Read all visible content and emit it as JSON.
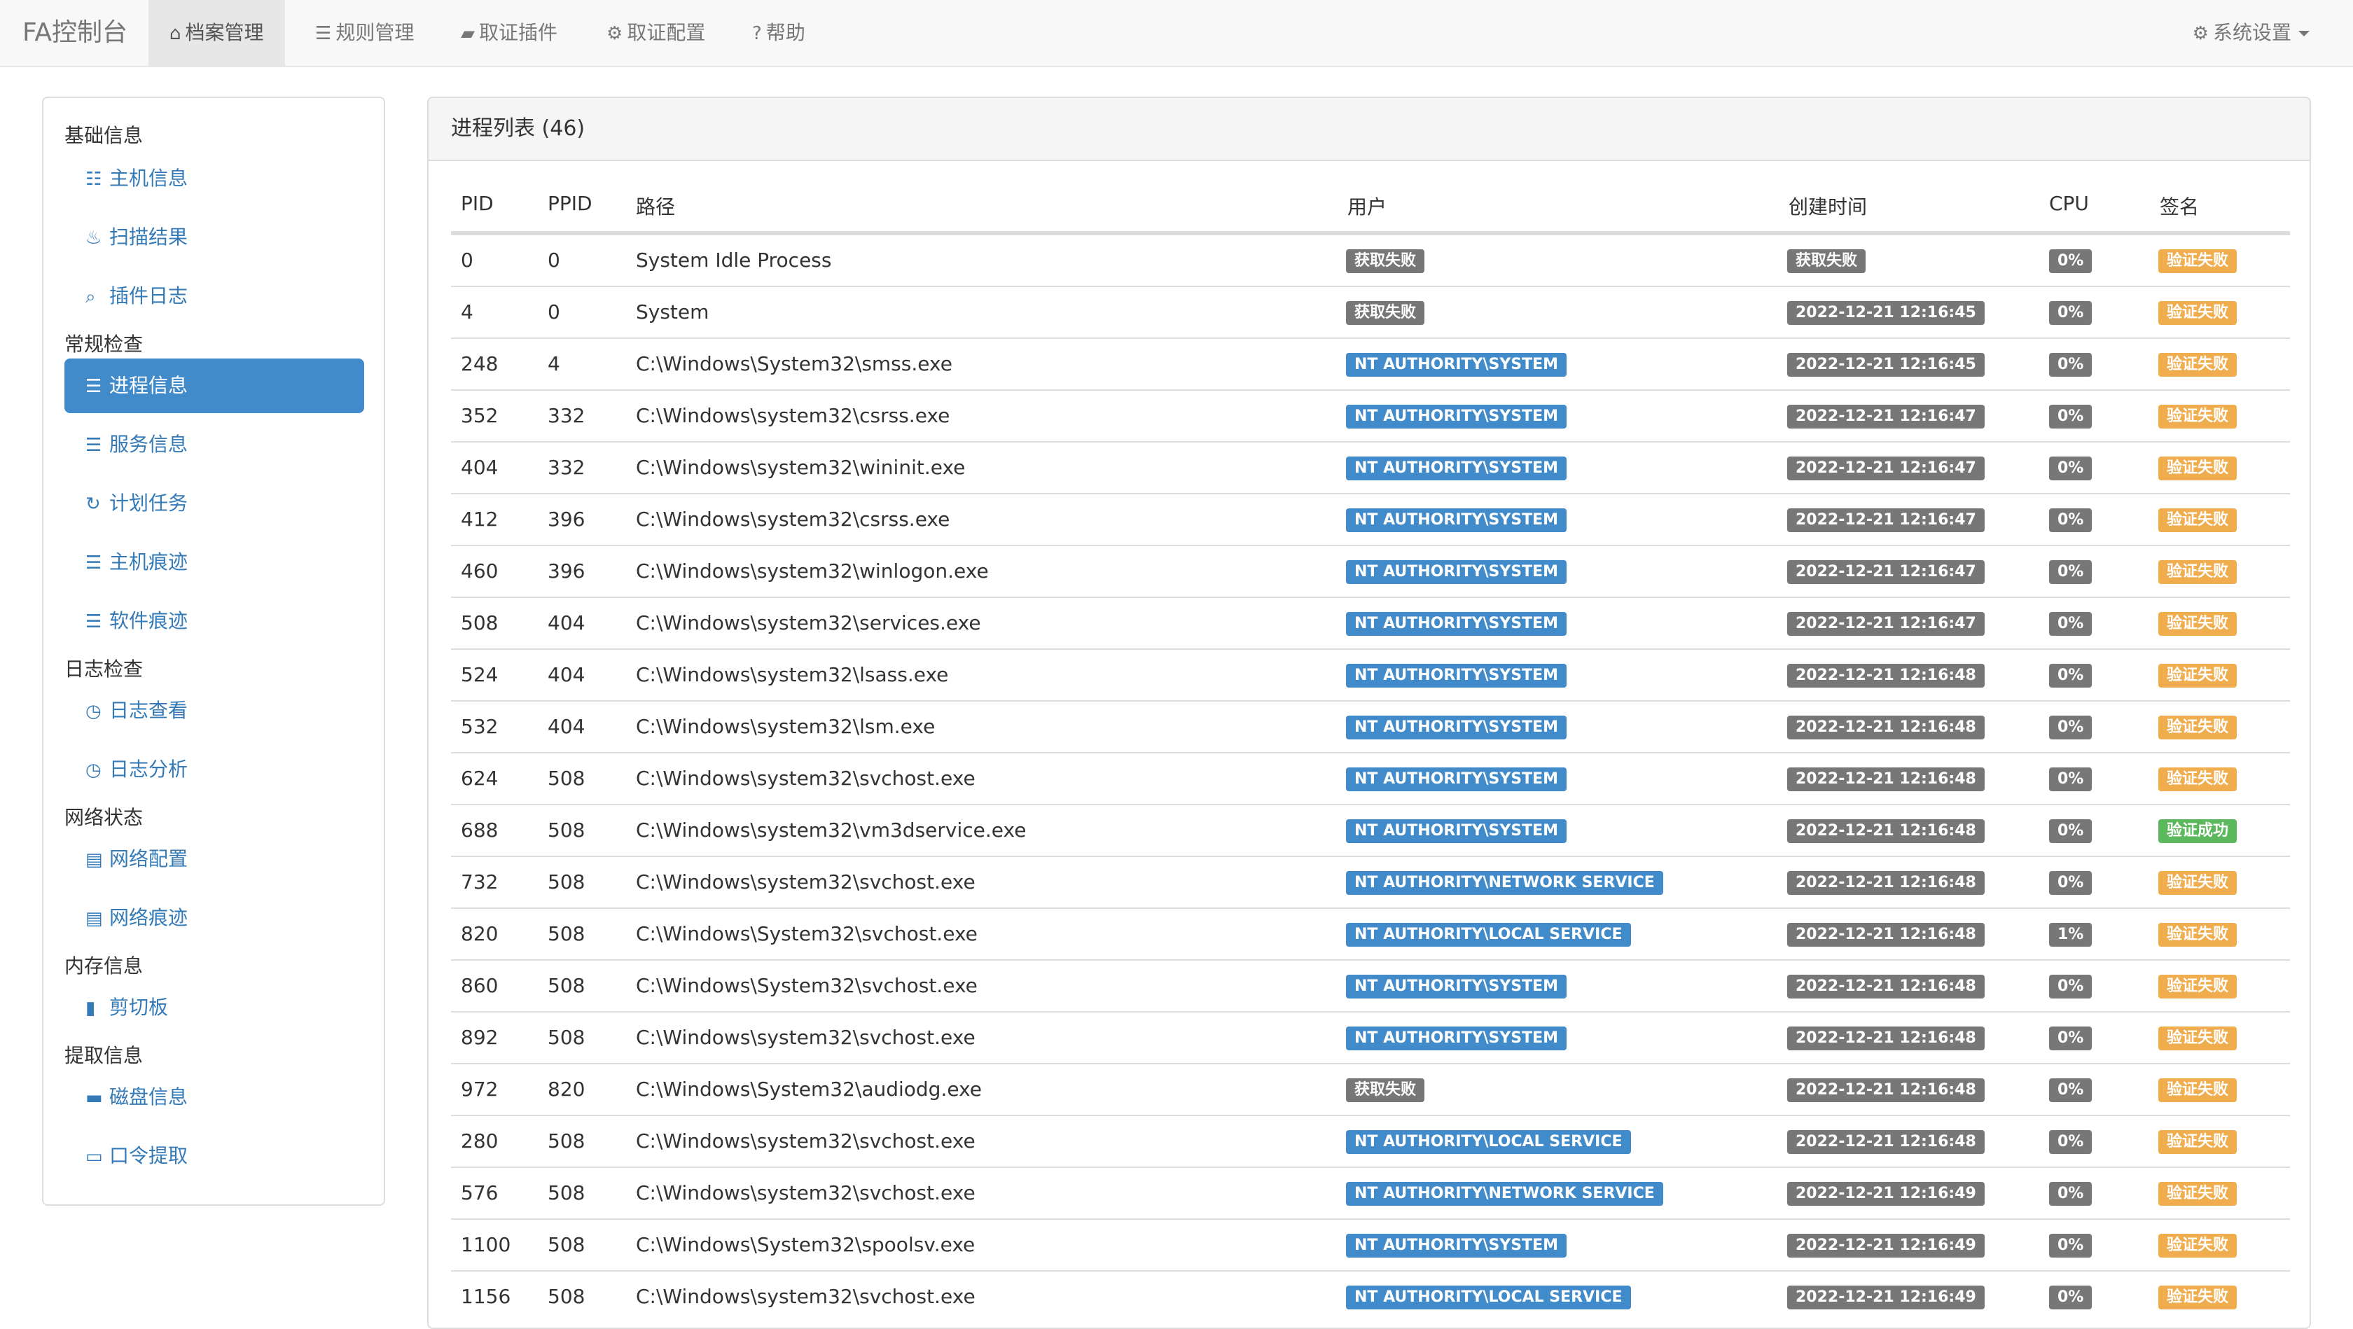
{
  "navbar": {
    "brand": "FA控制台",
    "items": [
      {
        "label": "档案管理",
        "icon": "home-icon",
        "active": true
      },
      {
        "label": "规则管理",
        "icon": "list-icon"
      },
      {
        "label": "取证插件",
        "icon": "folder-open-icon"
      },
      {
        "label": "取证配置",
        "icon": "cog-icon"
      },
      {
        "label": "帮助",
        "icon": "question-circle-icon"
      }
    ],
    "settings_label": "系统设置"
  },
  "sidebar": {
    "sections": [
      {
        "title": "基础信息",
        "items": [
          {
            "label": "主机信息",
            "icon": "th-list-icon"
          },
          {
            "label": "扫描结果",
            "icon": "fire-icon"
          },
          {
            "label": "插件日志",
            "icon": "search-icon"
          }
        ]
      },
      {
        "title": "常规检查",
        "items": [
          {
            "label": "进程信息",
            "icon": "tasks-icon",
            "active": true
          },
          {
            "label": "服务信息",
            "icon": "tasks-icon"
          },
          {
            "label": "计划任务",
            "icon": "refresh-icon"
          },
          {
            "label": "主机痕迹",
            "icon": "tasks-icon"
          },
          {
            "label": "软件痕迹",
            "icon": "tasks-icon"
          }
        ]
      },
      {
        "title": "日志检查",
        "items": [
          {
            "label": "日志查看",
            "icon": "clock-icon"
          },
          {
            "label": "日志分析",
            "icon": "clock-icon"
          }
        ]
      },
      {
        "title": "网络状态",
        "items": [
          {
            "label": "网络配置",
            "icon": "list-alt-icon"
          },
          {
            "label": "网络痕迹",
            "icon": "list-alt-icon"
          }
        ]
      },
      {
        "title": "内存信息",
        "items": [
          {
            "label": "剪切板",
            "icon": "file-icon"
          }
        ]
      },
      {
        "title": "提取信息",
        "items": [
          {
            "label": "磁盘信息",
            "icon": "hdd-icon"
          },
          {
            "label": "口令提取",
            "icon": "credit-card-icon"
          }
        ]
      }
    ]
  },
  "panel": {
    "title": "进程列表 (46)",
    "columns": [
      "PID",
      "PPID",
      "路径",
      "用户",
      "创建时间",
      "CPU",
      "签名"
    ],
    "rows": [
      {
        "pid": "0",
        "ppid": "0",
        "path": "System Idle Process",
        "user": "获取失败",
        "user_kind": "fail",
        "time": "获取失败",
        "cpu": "0%",
        "sig": "验证失败",
        "sig_ok": false
      },
      {
        "pid": "4",
        "ppid": "0",
        "path": "System",
        "user": "获取失败",
        "user_kind": "fail",
        "time": "2022-12-21 12:16:45",
        "cpu": "0%",
        "sig": "验证失败",
        "sig_ok": false
      },
      {
        "pid": "248",
        "ppid": "4",
        "path": "C:\\Windows\\System32\\smss.exe",
        "user": "NT AUTHORITY\\SYSTEM",
        "user_kind": "ok",
        "time": "2022-12-21 12:16:45",
        "cpu": "0%",
        "sig": "验证失败",
        "sig_ok": false
      },
      {
        "pid": "352",
        "ppid": "332",
        "path": "C:\\Windows\\system32\\csrss.exe",
        "user": "NT AUTHORITY\\SYSTEM",
        "user_kind": "ok",
        "time": "2022-12-21 12:16:47",
        "cpu": "0%",
        "sig": "验证失败",
        "sig_ok": false
      },
      {
        "pid": "404",
        "ppid": "332",
        "path": "C:\\Windows\\system32\\wininit.exe",
        "user": "NT AUTHORITY\\SYSTEM",
        "user_kind": "ok",
        "time": "2022-12-21 12:16:47",
        "cpu": "0%",
        "sig": "验证失败",
        "sig_ok": false
      },
      {
        "pid": "412",
        "ppid": "396",
        "path": "C:\\Windows\\system32\\csrss.exe",
        "user": "NT AUTHORITY\\SYSTEM",
        "user_kind": "ok",
        "time": "2022-12-21 12:16:47",
        "cpu": "0%",
        "sig": "验证失败",
        "sig_ok": false
      },
      {
        "pid": "460",
        "ppid": "396",
        "path": "C:\\Windows\\system32\\winlogon.exe",
        "user": "NT AUTHORITY\\SYSTEM",
        "user_kind": "ok",
        "time": "2022-12-21 12:16:47",
        "cpu": "0%",
        "sig": "验证失败",
        "sig_ok": false
      },
      {
        "pid": "508",
        "ppid": "404",
        "path": "C:\\Windows\\system32\\services.exe",
        "user": "NT AUTHORITY\\SYSTEM",
        "user_kind": "ok",
        "time": "2022-12-21 12:16:47",
        "cpu": "0%",
        "sig": "验证失败",
        "sig_ok": false
      },
      {
        "pid": "524",
        "ppid": "404",
        "path": "C:\\Windows\\system32\\lsass.exe",
        "user": "NT AUTHORITY\\SYSTEM",
        "user_kind": "ok",
        "time": "2022-12-21 12:16:48",
        "cpu": "0%",
        "sig": "验证失败",
        "sig_ok": false
      },
      {
        "pid": "532",
        "ppid": "404",
        "path": "C:\\Windows\\system32\\lsm.exe",
        "user": "NT AUTHORITY\\SYSTEM",
        "user_kind": "ok",
        "time": "2022-12-21 12:16:48",
        "cpu": "0%",
        "sig": "验证失败",
        "sig_ok": false
      },
      {
        "pid": "624",
        "ppid": "508",
        "path": "C:\\Windows\\system32\\svchost.exe",
        "user": "NT AUTHORITY\\SYSTEM",
        "user_kind": "ok",
        "time": "2022-12-21 12:16:48",
        "cpu": "0%",
        "sig": "验证失败",
        "sig_ok": false
      },
      {
        "pid": "688",
        "ppid": "508",
        "path": "C:\\Windows\\system32\\vm3dservice.exe",
        "user": "NT AUTHORITY\\SYSTEM",
        "user_kind": "ok",
        "time": "2022-12-21 12:16:48",
        "cpu": "0%",
        "sig": "验证成功",
        "sig_ok": true
      },
      {
        "pid": "732",
        "ppid": "508",
        "path": "C:\\Windows\\system32\\svchost.exe",
        "user": "NT AUTHORITY\\NETWORK SERVICE",
        "user_kind": "ok",
        "time": "2022-12-21 12:16:48",
        "cpu": "0%",
        "sig": "验证失败",
        "sig_ok": false
      },
      {
        "pid": "820",
        "ppid": "508",
        "path": "C:\\Windows\\System32\\svchost.exe",
        "user": "NT AUTHORITY\\LOCAL SERVICE",
        "user_kind": "ok",
        "time": "2022-12-21 12:16:48",
        "cpu": "1%",
        "sig": "验证失败",
        "sig_ok": false
      },
      {
        "pid": "860",
        "ppid": "508",
        "path": "C:\\Windows\\System32\\svchost.exe",
        "user": "NT AUTHORITY\\SYSTEM",
        "user_kind": "ok",
        "time": "2022-12-21 12:16:48",
        "cpu": "0%",
        "sig": "验证失败",
        "sig_ok": false
      },
      {
        "pid": "892",
        "ppid": "508",
        "path": "C:\\Windows\\system32\\svchost.exe",
        "user": "NT AUTHORITY\\SYSTEM",
        "user_kind": "ok",
        "time": "2022-12-21 12:16:48",
        "cpu": "0%",
        "sig": "验证失败",
        "sig_ok": false
      },
      {
        "pid": "972",
        "ppid": "820",
        "path": "C:\\Windows\\System32\\audiodg.exe",
        "user": "获取失败",
        "user_kind": "fail",
        "time": "2022-12-21 12:16:48",
        "cpu": "0%",
        "sig": "验证失败",
        "sig_ok": false
      },
      {
        "pid": "280",
        "ppid": "508",
        "path": "C:\\Windows\\system32\\svchost.exe",
        "user": "NT AUTHORITY\\LOCAL SERVICE",
        "user_kind": "ok",
        "time": "2022-12-21 12:16:48",
        "cpu": "0%",
        "sig": "验证失败",
        "sig_ok": false
      },
      {
        "pid": "576",
        "ppid": "508",
        "path": "C:\\Windows\\system32\\svchost.exe",
        "user": "NT AUTHORITY\\NETWORK SERVICE",
        "user_kind": "ok",
        "time": "2022-12-21 12:16:49",
        "cpu": "0%",
        "sig": "验证失败",
        "sig_ok": false
      },
      {
        "pid": "1100",
        "ppid": "508",
        "path": "C:\\Windows\\System32\\spoolsv.exe",
        "user": "NT AUTHORITY\\SYSTEM",
        "user_kind": "ok",
        "time": "2022-12-21 12:16:49",
        "cpu": "0%",
        "sig": "验证失败",
        "sig_ok": false
      },
      {
        "pid": "1156",
        "ppid": "508",
        "path": "C:\\Windows\\system32\\svchost.exe",
        "user": "NT AUTHORITY\\LOCAL SERVICE",
        "user_kind": "ok",
        "time": "2022-12-21 12:16:49",
        "cpu": "0%",
        "sig": "验证失败",
        "sig_ok": false
      }
    ]
  },
  "colors": {
    "primary": "#428bca",
    "default": "#777777",
    "warning": "#f0ad4e",
    "success": "#5cb85c",
    "link": "#337ab7"
  }
}
